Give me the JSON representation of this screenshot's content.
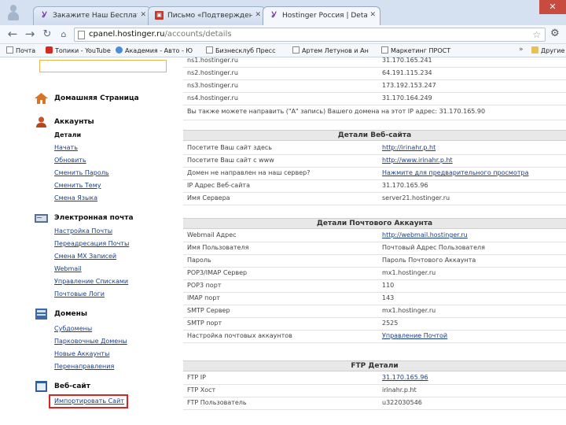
{
  "browser": {
    "tabs": [
      {
        "label": "Закажите Наш Бесплатны",
        "icon": "hostinger-favicon"
      },
      {
        "label": "Письмо «Подтверждение",
        "icon": "pdf-favicon"
      },
      {
        "label": "Hostinger Россия | Details",
        "icon": "hostinger-favicon"
      }
    ],
    "url_prefix": "cpanel.hostinger.ru",
    "url_path": "/accounts/details",
    "bookmarks": [
      "Почта",
      "Топики - YouTube",
      "Академия - Авто - Ю",
      "Бизнесклуб Пресс",
      "Артем Летунов и Ан",
      "Маркетинг ПРОСТ"
    ],
    "bookmarks_more": "»",
    "other_bookmarks": "Другие"
  },
  "sidebar": {
    "sections": [
      {
        "title": "Домашняя Страница",
        "icon": "home-icon",
        "links": []
      },
      {
        "title": "Аккаунты",
        "icon": "user-icon",
        "links": [
          "Детали",
          "Начать",
          "Обновить",
          "Сменить Пароль",
          "Сменить Тему",
          "Смена Языка"
        ]
      },
      {
        "title": "Электронная почта",
        "icon": "mail-icon",
        "links": [
          "Настройка Почты",
          "Переадресация Почты",
          "Смена МХ Записей",
          "Webmail",
          "Управление Списками",
          "Почтовые Логи"
        ]
      },
      {
        "title": "Домены",
        "icon": "domain-icon",
        "links": [
          "Субдомены",
          "Парковочные Домены",
          "Новые Аккаунты",
          "Перенаправления"
        ]
      },
      {
        "title": "Веб-сайт",
        "icon": "website-icon",
        "links": [
          "Импортировать Сайт"
        ]
      }
    ]
  },
  "main": {
    "top_rows": [
      {
        "key": "ns1.hostinger.ru",
        "value": "31.170.165.241"
      },
      {
        "key": "ns2.hostinger.ru",
        "value": "64.191.115.234"
      },
      {
        "key": "ns3.hostinger.ru",
        "value": "173.192.153.247"
      },
      {
        "key": "ns4.hostinger.ru",
        "value": "31.170.164.249"
      }
    ],
    "note": "Вы также можете направить (\"A\" запись) Вашего домена на этот IP адрес: 31.170.165.90",
    "website": {
      "title": "Детали Веб-сайта",
      "rows": [
        {
          "key": "Посетите Ваш сайт здесь",
          "value": "http://irinahr.p.ht",
          "link": true
        },
        {
          "key": "Посетите Ваш сайт с www",
          "value": "http://www.irinahr.p.ht",
          "link": true
        },
        {
          "key": "Домен не направлен на наш сервер?",
          "value": "Нажмите для предварительного просмотра",
          "link": true
        },
        {
          "key": "IP Адрес Веб-сайта",
          "value": "31.170.165.96",
          "link": false
        },
        {
          "key": "Имя Сервера",
          "value": "server21.hostinger.ru",
          "link": false
        }
      ]
    },
    "mail": {
      "title": "Детали Почтового Аккаунта",
      "rows": [
        {
          "key": "Webmail Адрес",
          "value": "http://webmail.hostinger.ru",
          "link": true
        },
        {
          "key": "Имя Пользователя",
          "value": "Почтовый Адрес Пользователя",
          "link": false
        },
        {
          "key": "Пароль",
          "value": "Пароль Почтового Аккаунта",
          "link": false
        },
        {
          "key": "POP3/IMAP Сервер",
          "value": "mx1.hostinger.ru",
          "link": false
        },
        {
          "key": "POP3 порт",
          "value": "110",
          "link": false
        },
        {
          "key": "IMAP порт",
          "value": "143",
          "link": false
        },
        {
          "key": "SMTP Сервер",
          "value": "mx1.hostinger.ru",
          "link": false
        },
        {
          "key": "SMTP порт",
          "value": "2525",
          "link": false
        },
        {
          "key": "Настройка почтовых аккаунтов",
          "value": "Управление Почтой",
          "link": true
        }
      ]
    },
    "ftp": {
      "title": "FTP Детали",
      "rows": [
        {
          "key": "FTP IP",
          "value": "31.170.165.96",
          "link": true
        },
        {
          "key": "FTP Хост",
          "value": "irinahr.p.ht",
          "link": false
        },
        {
          "key": "FTP Пользователь",
          "value": "u322030546",
          "link": false
        }
      ]
    }
  }
}
